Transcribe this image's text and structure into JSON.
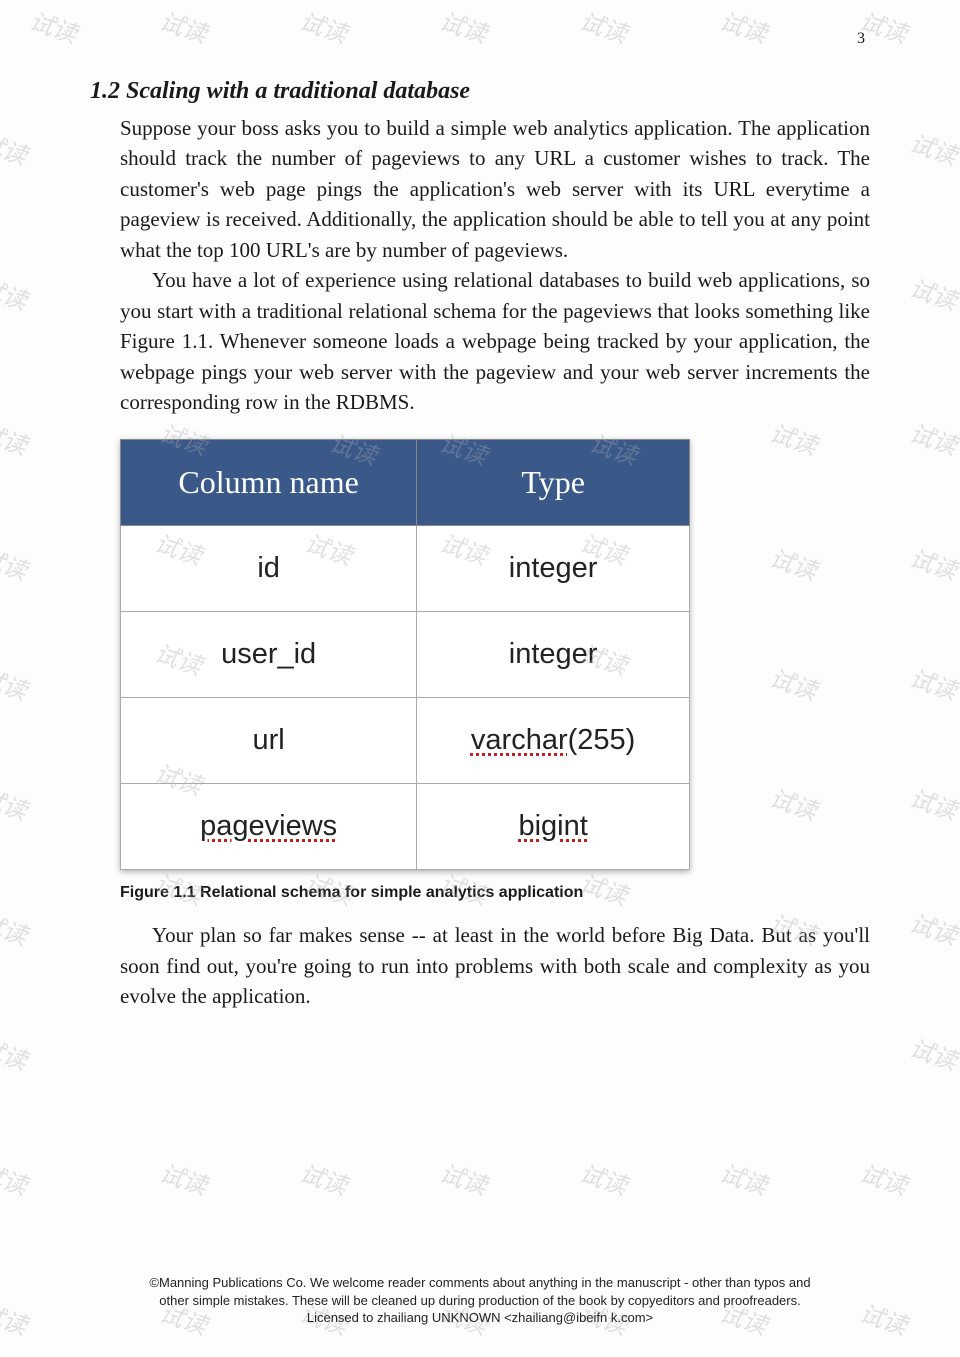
{
  "page_number": "3",
  "heading": "1.2 Scaling with a traditional database",
  "para1": "Suppose your boss asks you to build a simple web analytics application. The application should track the number of pageviews to any URL a customer wishes to track. The customer's web page pings the application's web server with its URL everytime a pageview is received. Additionally, the application should be able to tell you at any point what the top 100 URL's are by number of pageviews.",
  "para2": "You have a lot of experience using relational databases to build web applications, so you start with a traditional relational schema for the pageviews that looks something like Figure 1.1. Whenever someone loads a webpage being tracked by your application, the webpage pings your web server with the pageview and your web server increments the corresponding row in the RDBMS.",
  "table": {
    "headers": [
      "Column name",
      "Type"
    ],
    "rows": [
      {
        "col": "id",
        "type": "integer",
        "col_ul": false,
        "type_ul": false
      },
      {
        "col": "user_id",
        "type": "integer",
        "col_ul": false,
        "type_ul": false
      },
      {
        "col": "url",
        "type_prefix": "varchar",
        "type_suffix": "(255)",
        "col_ul": false,
        "type_ul": true
      },
      {
        "col": "pageviews",
        "type": "bigint",
        "col_ul": true,
        "type_ul": true
      }
    ]
  },
  "figcap": "Figure 1.1 Relational schema for simple analytics application",
  "para3": "Your plan so far makes sense -- at least in the world before Big Data. But as you'll soon find out, you're going to run into problems with both scale and complexity as you evolve the application.",
  "footer1": "©Manning Publications Co. We welcome reader comments about anything in the manuscript - other than typos and",
  "footer2": "other simple mistakes. These will be cleaned up during production of the book by copyeditors and proofreaders.",
  "footer3": "Licensed to zhailiang UNKNOWN <zhailiang@ibeifn k.com>",
  "watermark_text": "试读"
}
